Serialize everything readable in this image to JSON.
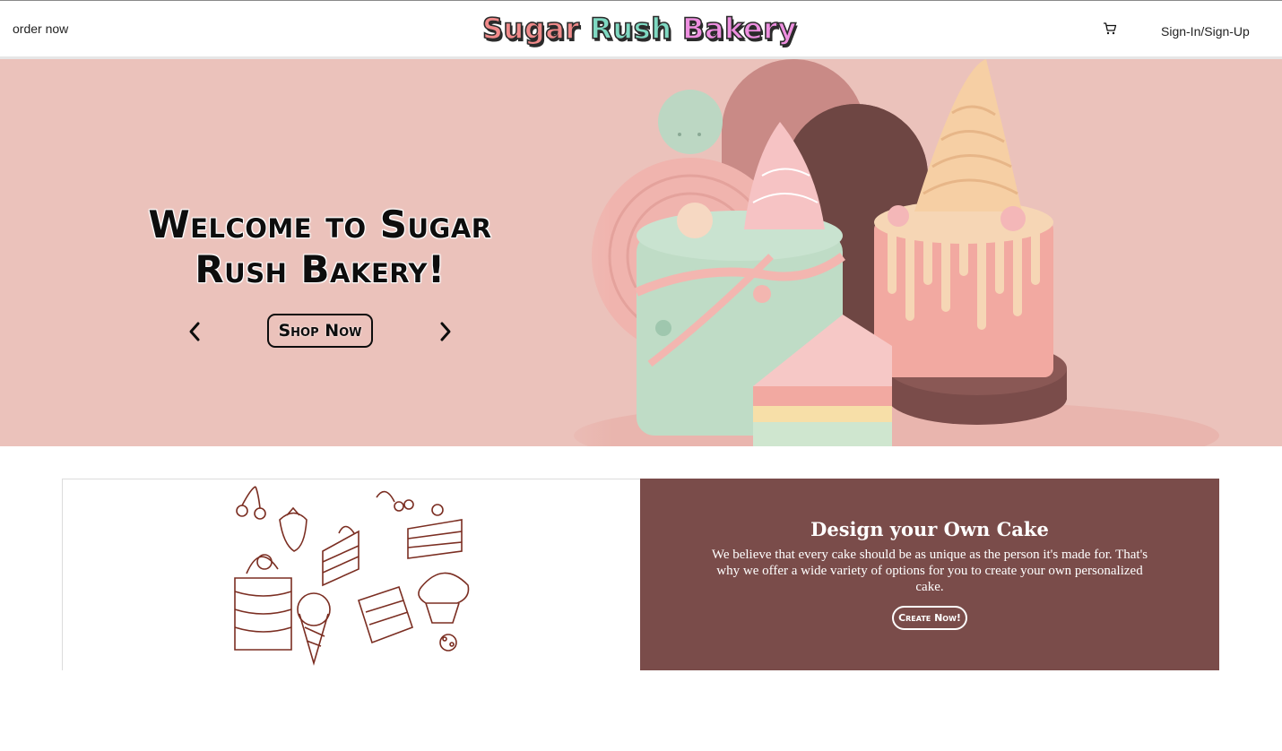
{
  "nav": {
    "order_label": "order now",
    "logo": {
      "word1": "Sugar",
      "word2": "Rush",
      "word3": "Bakery"
    },
    "cart_icon": "cart-icon",
    "sign_label": "Sign-In/Sign-Up"
  },
  "hero": {
    "title": "Welcome to Sugar Rush Bakery!",
    "shop_label": "Shop Now",
    "prev_icon": "chevron-left-icon",
    "next_icon": "chevron-right-icon",
    "background_color": "#ebc2bb"
  },
  "design": {
    "title": "Design your Own Cake",
    "description": "We believe that every cake should be as unique as the person it's made for. That's why we offer a wide variety of options for you to create your own personalized cake.",
    "create_label": "Create Now!",
    "panel_color": "#7a4c4a"
  }
}
